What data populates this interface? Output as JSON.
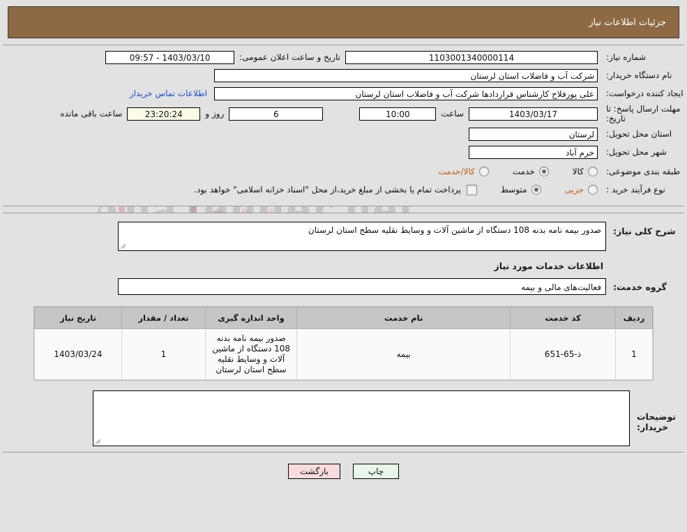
{
  "header": {
    "title": "جزئیات اطلاعات نیاز"
  },
  "form": {
    "need_number_label": "شماره نیاز:",
    "need_number_value": "1103001340000114",
    "public_announce_label": "تاریخ و ساعت اعلان عمومی:",
    "public_announce_value": "1403/03/10 - 09:57",
    "buyer_org_label": "نام دستگاه خریدار:",
    "buyer_org_value": "شرکت آب و فاضلاب استان لرستان",
    "creator_label": "ایجاد کننده درخواست:",
    "creator_value": "علی پورفلاح کارشناس قراردادها شرکت آب و فاضلاب استان لرستان",
    "contact_link": "اطلاعات تماس خریدار",
    "deadline_label": "مهلت ارسال پاسخ: تا تاریخ:",
    "deadline_date": "1403/03/17",
    "hour_word": "ساعت",
    "deadline_time": "10:00",
    "days_value": "6",
    "days_word": "روز و",
    "remaining_time": "23:20:24",
    "remaining_word": "ساعت باقی مانده",
    "delivery_province_label": "استان محل تحویل:",
    "delivery_province_value": "لرستان",
    "delivery_city_label": "شهر محل تحویل:",
    "delivery_city_value": "خرم آباد",
    "category_label": "طبقه بندی موضوعی:",
    "category_options": [
      {
        "label": "کالا",
        "selected": false,
        "accent": false
      },
      {
        "label": "خدمت",
        "selected": true,
        "accent": false
      },
      {
        "label": "کالا/خدمت",
        "selected": false,
        "accent": true
      }
    ],
    "purchase_type_label": "نوع فرآیند خرید :",
    "purchase_options": [
      {
        "label": "جزیی",
        "selected": false,
        "accent": true
      },
      {
        "label": "متوسط",
        "selected": true,
        "accent": false
      }
    ],
    "treasury_note": "پرداخت تمام یا بخشی از مبلغ خرید،از محل \"اسناد خزانه اسلامی\" خواهد بود."
  },
  "need_description": {
    "label": "شرح کلی نیاز:",
    "value": "صدور بیمه نامه بدنه  108 دستگاه از ماشین آلات و وسایط نقلیه سطح استان لرستان"
  },
  "services_section": {
    "title": "اطلاعات خدمات مورد نیاز",
    "group_label": "گروه خدمت:",
    "group_value": "فعالیت‌های مالی و بیمه"
  },
  "table": {
    "headers": [
      "ردیف",
      "کد خدمت",
      "نام خدمت",
      "واحد اندازه گیری",
      "تعداد / مقدار",
      "تاریخ نیاز"
    ],
    "rows": [
      {
        "radif": "1",
        "code": "ذ-65-651",
        "name": "بیمه",
        "unit": "صدور بیمه نامه بدنه 108 دستگاه از ماشین آلات و وسایط نقلیه سطح استان لرستان",
        "qty": "1",
        "date": "1403/03/24"
      }
    ]
  },
  "buyer_notes": {
    "label": "توضیحات خریدار:",
    "value": ""
  },
  "footer": {
    "print_label": "چاپ",
    "back_label": "بازگشت"
  },
  "watermark": {
    "text": "AnaTender.net"
  },
  "colors": {
    "header_bar": "#8d6a43",
    "link": "#1b4dd0",
    "accent_text": "#c15a12",
    "print_btn": "#e9f7e9",
    "back_btn": "#fbdcdc",
    "highlight_field": "#fbfbe8"
  }
}
